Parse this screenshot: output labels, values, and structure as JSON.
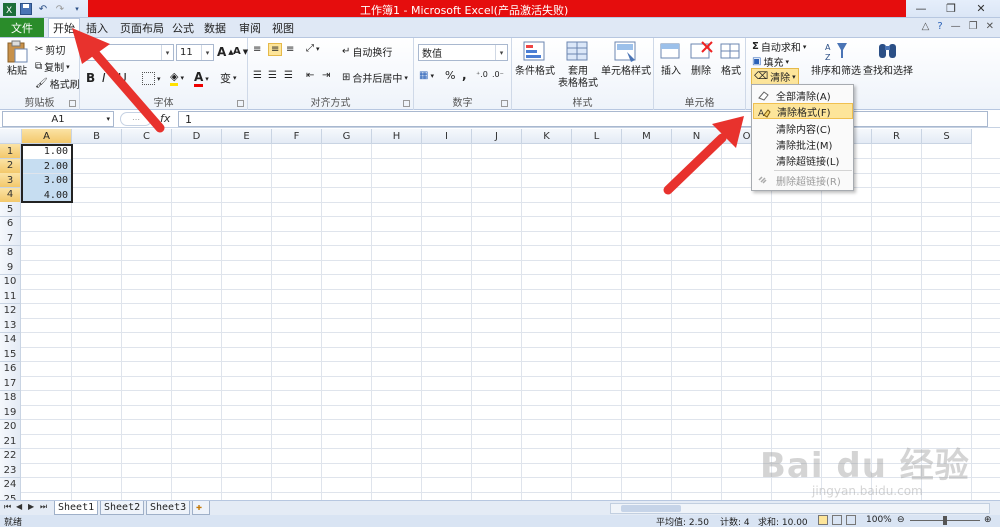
{
  "window": {
    "title": "工作簿1 - Microsoft Excel(产品激活失败)"
  },
  "tabs": [
    {
      "label": "文件"
    },
    {
      "label": "开始"
    },
    {
      "label": "插入"
    },
    {
      "label": "页面布局"
    },
    {
      "label": "公式"
    },
    {
      "label": "数据"
    },
    {
      "label": "审阅"
    },
    {
      "label": "视图"
    }
  ],
  "ribbon": {
    "clipboard": {
      "paste": "粘贴",
      "cut": "剪切",
      "copy": "复制",
      "format_painter": "格式刷",
      "label": "剪贴板"
    },
    "font": {
      "size": "11",
      "label": "字体",
      "bold": "B",
      "italic": "I",
      "underline": "U",
      "grow": "A",
      "shrink": "A",
      "font_color": "A",
      "wen": "变"
    },
    "alignment": {
      "wrap": "自动换行",
      "merge": "合并后居中",
      "label": "对齐方式"
    },
    "number": {
      "format": "数值",
      "percent": "%",
      "comma": ",",
      "label": "数字"
    },
    "styles": {
      "conditional": "条件格式",
      "table_format_1": "套用",
      "table_format_2": "表格格式",
      "cell_styles": "单元格样式",
      "label": "样式"
    },
    "cells": {
      "insert": "插入",
      "delete": "删除",
      "format": "格式",
      "label": "单元格"
    },
    "editing": {
      "autosum": "自动求和",
      "fill": "填充",
      "clear": "清除",
      "sort": "排序和筛选",
      "find": "查找和选择"
    }
  },
  "formula_bar": {
    "name_box": "A1",
    "fx": "fx",
    "value": "1"
  },
  "columns": [
    "A",
    "B",
    "C",
    "D",
    "E",
    "F",
    "G",
    "H",
    "I",
    "J",
    "K",
    "L",
    "M",
    "N",
    "O",
    "P",
    "Q",
    "R",
    "S"
  ],
  "rows": [
    "1",
    "2",
    "3",
    "4",
    "5",
    "6",
    "7",
    "8",
    "9",
    "10",
    "11",
    "12",
    "13",
    "14",
    "15",
    "16",
    "17",
    "18",
    "19",
    "20",
    "21",
    "22",
    "23",
    "24",
    "25"
  ],
  "cells": [
    "1.00",
    "2.00",
    "3.00",
    "4.00"
  ],
  "clear_menu": {
    "items": [
      {
        "label": "全部清除(A)"
      },
      {
        "label": "清除格式(F)"
      },
      {
        "label": "清除内容(C)"
      },
      {
        "label": "清除批注(M)"
      },
      {
        "label": "清除超链接(L)"
      },
      {
        "label": "删除超链接(R)"
      }
    ]
  },
  "sheets": [
    "Sheet1",
    "Sheet2",
    "Sheet3"
  ],
  "status": {
    "ready": "就绪",
    "average": "平均值: 2.50",
    "count": "计数: 4",
    "sum": "求和: 10.00",
    "zoom": "100%"
  },
  "watermark": {
    "brand": "Bai du 经验",
    "url": "jingyan.baidu.com"
  },
  "colors": {
    "file_tab": "#2a8c2a",
    "title_highlight": "#e50d0d",
    "selection": "#c6ddf1",
    "menu_highlight": "#fde59a",
    "arrow": "#e8322d"
  }
}
